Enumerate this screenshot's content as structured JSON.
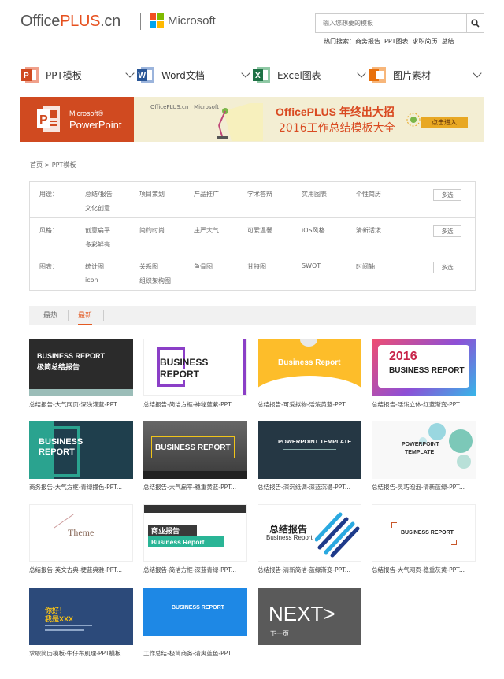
{
  "header": {
    "logo_office": "Office",
    "logo_plus": "PLUS",
    "logo_cn": ".cn",
    "ms_text": "Microsoft",
    "search_placeholder": "输入您想要的模板",
    "hot_label": "热门搜索：",
    "hot_items": [
      "商务报告",
      "PPT图表",
      "求职简历",
      "总结"
    ]
  },
  "categories": [
    {
      "label": "PPT模板",
      "icon": "powerpoint-icon",
      "color": "#d04a20"
    },
    {
      "label": "Word文档",
      "icon": "word-icon",
      "color": "#2b5797"
    },
    {
      "label": "Excel图表",
      "icon": "excel-icon",
      "color": "#1e7145"
    },
    {
      "label": "图片素材",
      "icon": "image-icon",
      "color": "#e8700c"
    }
  ],
  "banner": {
    "ms": "Microsoft®",
    "powerpoint": "PowerPoint",
    "brand": "OfficePLUS.cn | Microsoft",
    "title": "OfficePLUS 年终出大招",
    "subtitle": "2016工作总结模板大全",
    "cta": "点击进入"
  },
  "breadcrumb": "首页 > PPT模板",
  "filters": {
    "usage": {
      "label": "用途：",
      "items": [
        "总结/报告",
        "项目策划",
        "产品推广",
        "学术答辩",
        "实用图表",
        "个性简历",
        "文化创意"
      ]
    },
    "style": {
      "label": "风格：",
      "items": [
        "创意扁平",
        "简约时尚",
        "庄严大气",
        "可爱温馨",
        "iOS风格",
        "清新活泼",
        "多彩鲜亮"
      ]
    },
    "chart": {
      "label": "图表：",
      "items": [
        "统计图",
        "关系图",
        "鱼骨图",
        "甘特图",
        "SWOT",
        "时间轴",
        "icon",
        "组织架构图"
      ]
    },
    "multi": "多选"
  },
  "sort": {
    "hot": "最热",
    "new": "最新"
  },
  "cards": [
    {
      "title": "总结报告-大气网页-深浅灌蓝-PPT...",
      "thumb1": "BUSINESS REPORT",
      "thumb2": "极简总结报告"
    },
    {
      "title": "总结报告-简洁方框-神秘蓝紫-PPT...",
      "thumb1": "BUSINESS",
      "thumb2": "REPORT"
    },
    {
      "title": "总结报告-可爱拟物-活泼黄蓝-PPT...",
      "thumb1": "Business Report",
      "thumb2": ""
    },
    {
      "title": "总结报告-活泼立体-红蓝渐变-PPT...",
      "thumb1": "2016",
      "thumb2": "BUSINESS REPORT"
    },
    {
      "title": "商务报告-大气方框-青绿撞色-PPT...",
      "thumb1": "BUSINESS",
      "thumb2": "REPORT"
    },
    {
      "title": "总结报告-大气扁平-稳重黄蓝-PPT...",
      "thumb1": "BUSINESS REPORT",
      "thumb2": ""
    },
    {
      "title": "总结报告-深沉纸调-深蓝沉稳-PPT...",
      "thumb1": "POWERPOINT TEMPLATE",
      "thumb2": ""
    },
    {
      "title": "总结报告-灵巧泡泡-清新蓝绿-PPT...",
      "thumb1": "POWERPOINT",
      "thumb2": "TEMPLATE"
    },
    {
      "title": "总结报告-英文古典-梗蓝典雅-PPT...",
      "thumb1": "Theme",
      "thumb2": ""
    },
    {
      "title": "总结报告-简洁方框-深蓝青绿-PPT...",
      "thumb1": "商业报告",
      "thumb2": "Business Report"
    },
    {
      "title": "总结报告-清新简洁-蓝绿渐变-PPT...",
      "thumb1": "总结报告",
      "thumb2": "Business Report"
    },
    {
      "title": "总结报告-大气网页-稳重灰黄-PPT...",
      "thumb1": "BUSINESS REPORT",
      "thumb2": ""
    },
    {
      "title": "求职简历模板-牛仔布肌理-PPT模板",
      "thumb1": "你好！",
      "thumb2": "我是XXX"
    },
    {
      "title": "工作总结-极简商务-清爽蓝色-PPT...",
      "thumb1": "BUSINESS REPORT",
      "thumb2": ""
    }
  ],
  "next": {
    "label": "NEXT>",
    "sub": "下一页"
  }
}
